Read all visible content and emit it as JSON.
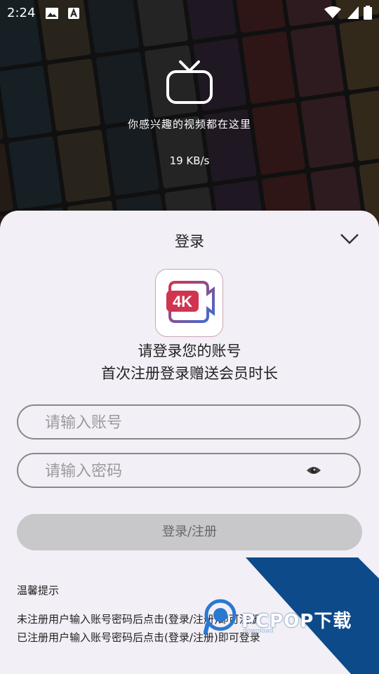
{
  "status_bar": {
    "time": "2:24"
  },
  "hero": {
    "tagline": "你感兴趣的视频都在这里",
    "speed": "19 KB/s"
  },
  "sheet": {
    "title": "登录",
    "intro_line1": "请登录您的账号",
    "intro_line2": "首次注册登录赠送会员时长",
    "logo_text": "4K"
  },
  "form": {
    "account_placeholder": "请输入账号",
    "password_placeholder": "请输入密码",
    "submit_label": "登录/注册"
  },
  "notes": {
    "heading": "温馨提示",
    "line1": "未注册用户输入账号密码后点击(登录/注册)即可注册",
    "line2": "已注册用户输入账号密码后点击(登录/注册)即可登录"
  },
  "watermark": {
    "text": "PCPOP下载",
    "sub": "download"
  },
  "colors": {
    "sheet_bg": "#f2eff6",
    "button_bg": "#c8c8cb",
    "logo_pink": "#d0344f",
    "logo_blue": "#3a6fd8",
    "watermark_blue": "#0d4a8a"
  }
}
